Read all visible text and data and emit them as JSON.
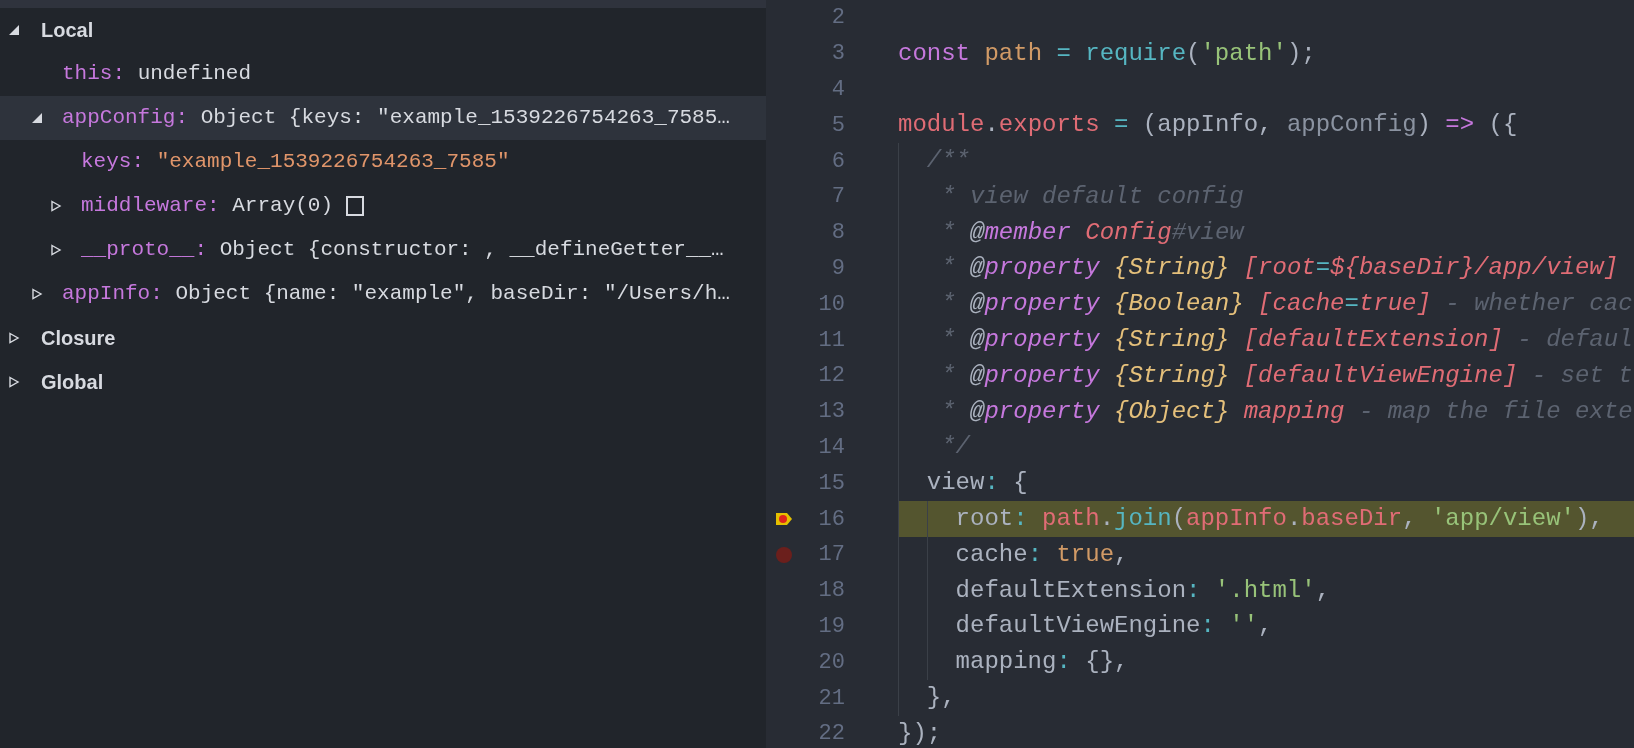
{
  "scope_tree": [
    {
      "label": "Local",
      "kind": "section",
      "expanded": true,
      "children": [
        {
          "name": "this:",
          "value": "undefined",
          "kind": "leaf",
          "string_value": false,
          "selected": false
        },
        {
          "name": "appConfig:",
          "value": "Object {keys: \"example_1539226754263_7585…",
          "kind": "object",
          "expanded": true,
          "string_value": false,
          "selected": true,
          "children": [
            {
              "name": "keys:",
              "value": "\"example_1539226754263_7585\"",
              "kind": "leaf",
              "string_value": true,
              "selected": false
            },
            {
              "name": "middleware:",
              "value": "Array(0)",
              "kind": "array",
              "expanded": false,
              "string_value": false,
              "selected": false
            },
            {
              "name": "__proto__:",
              "value": "Object {constructor: , __defineGetter__…",
              "kind": "object",
              "expanded": false,
              "string_value": false,
              "selected": false
            }
          ]
        },
        {
          "name": "appInfo:",
          "value": "Object {name: \"example\", baseDir: \"/Users/h…",
          "kind": "object",
          "expanded": false,
          "string_value": false,
          "selected": false
        }
      ]
    },
    {
      "label": "Closure",
      "kind": "section",
      "expanded": false
    },
    {
      "label": "Global",
      "kind": "section",
      "expanded": false
    }
  ],
  "editor": {
    "lines": [
      {
        "number": "2",
        "breakpoint": false,
        "paused": false,
        "highlighted": false
      },
      {
        "number": "3",
        "breakpoint": false,
        "paused": false,
        "highlighted": false,
        "tokens": [
          {
            "text": "const",
            "kind": "keyword"
          },
          {
            "text": " path",
            "kind": "variable"
          },
          {
            "text": " =",
            "kind": "operator"
          },
          {
            "text": " require",
            "kind": "function"
          },
          {
            "text": "(",
            "kind": "plain"
          },
          {
            "text": "'path'",
            "kind": "string"
          },
          {
            "text": ");",
            "kind": "plain"
          }
        ]
      },
      {
        "number": "4",
        "breakpoint": false,
        "paused": false,
        "highlighted": false
      },
      {
        "number": "5",
        "breakpoint": false,
        "paused": false,
        "highlighted": false,
        "tokens": [
          {
            "text": "module",
            "kind": "member"
          },
          {
            "text": ".",
            "kind": "plain"
          },
          {
            "text": "exports",
            "kind": "member"
          },
          {
            "text": " =",
            "kind": "operator"
          },
          {
            "text": " (appInfo, ",
            "kind": "plain"
          },
          {
            "text": "appConfig",
            "kind": "unused"
          },
          {
            "text": ") ",
            "kind": "plain"
          },
          {
            "text": "=>",
            "kind": "keyword"
          },
          {
            "text": " ({",
            "kind": "plain"
          }
        ]
      },
      {
        "number": "6",
        "breakpoint": false,
        "paused": false,
        "highlighted": false,
        "tokens": [
          {
            "text": "  /**",
            "kind": "comment"
          }
        ]
      },
      {
        "number": "7",
        "breakpoint": false,
        "paused": false,
        "highlighted": false,
        "tokens": [
          {
            "text": "   * view default config",
            "kind": "comment"
          }
        ]
      },
      {
        "number": "8",
        "breakpoint": false,
        "paused": false,
        "highlighted": false,
        "tokens": [
          {
            "text": "   * ",
            "kind": "comment"
          },
          {
            "text": "@",
            "kind": "doc_at"
          },
          {
            "text": "member ",
            "kind": "doc_tag"
          },
          {
            "text": "Config",
            "kind": "doc_name"
          },
          {
            "text": "#view",
            "kind": "comment"
          }
        ]
      },
      {
        "number": "9",
        "breakpoint": false,
        "paused": false,
        "highlighted": false,
        "tokens": [
          {
            "text": "   * ",
            "kind": "comment"
          },
          {
            "text": "@",
            "kind": "doc_at"
          },
          {
            "text": "property ",
            "kind": "doc_tag"
          },
          {
            "text": "{String} ",
            "kind": "doc_type"
          },
          {
            "text": "[root",
            "kind": "doc_name"
          },
          {
            "text": "=",
            "kind": "doc_op"
          },
          {
            "text": "${baseDir}/app/view]",
            "kind": "doc_name"
          }
        ]
      },
      {
        "number": "10",
        "breakpoint": false,
        "paused": false,
        "highlighted": false,
        "tokens": [
          {
            "text": "   * ",
            "kind": "comment"
          },
          {
            "text": "@",
            "kind": "doc_at"
          },
          {
            "text": "property ",
            "kind": "doc_tag"
          },
          {
            "text": "{Boolean} ",
            "kind": "doc_type"
          },
          {
            "text": "[cache",
            "kind": "doc_name"
          },
          {
            "text": "=",
            "kind": "doc_op"
          },
          {
            "text": "true]",
            "kind": "doc_name"
          },
          {
            "text": " - whether cac",
            "kind": "comment"
          }
        ]
      },
      {
        "number": "11",
        "breakpoint": false,
        "paused": false,
        "highlighted": false,
        "tokens": [
          {
            "text": "   * ",
            "kind": "comment"
          },
          {
            "text": "@",
            "kind": "doc_at"
          },
          {
            "text": "property ",
            "kind": "doc_tag"
          },
          {
            "text": "{String} ",
            "kind": "doc_type"
          },
          {
            "text": "[defaultExtension]",
            "kind": "doc_name"
          },
          {
            "text": " - defaul",
            "kind": "comment"
          }
        ]
      },
      {
        "number": "12",
        "breakpoint": false,
        "paused": false,
        "highlighted": false,
        "tokens": [
          {
            "text": "   * ",
            "kind": "comment"
          },
          {
            "text": "@",
            "kind": "doc_at"
          },
          {
            "text": "property ",
            "kind": "doc_tag"
          },
          {
            "text": "{String} ",
            "kind": "doc_type"
          },
          {
            "text": "[defaultViewEngine]",
            "kind": "doc_name"
          },
          {
            "text": " - set t",
            "kind": "comment"
          }
        ]
      },
      {
        "number": "13",
        "breakpoint": false,
        "paused": false,
        "highlighted": false,
        "tokens": [
          {
            "text": "   * ",
            "kind": "comment"
          },
          {
            "text": "@",
            "kind": "doc_at"
          },
          {
            "text": "property ",
            "kind": "doc_tag"
          },
          {
            "text": "{Object} ",
            "kind": "doc_type"
          },
          {
            "text": "mapping",
            "kind": "doc_name"
          },
          {
            "text": " - map the file exte",
            "kind": "comment"
          }
        ]
      },
      {
        "number": "14",
        "breakpoint": false,
        "paused": false,
        "highlighted": false,
        "tokens": [
          {
            "text": "   */",
            "kind": "comment"
          }
        ]
      },
      {
        "number": "15",
        "breakpoint": false,
        "paused": false,
        "highlighted": false,
        "tokens": [
          {
            "text": "  view",
            "kind": "plain"
          },
          {
            "text": ":",
            "kind": "operator"
          },
          {
            "text": " {",
            "kind": "plain"
          }
        ]
      },
      {
        "number": "16",
        "breakpoint": true,
        "paused": true,
        "highlighted": true,
        "tokens": [
          {
            "text": "    root",
            "kind": "plain"
          },
          {
            "text": ": ",
            "kind": "operator"
          },
          {
            "text": "path",
            "kind": "member"
          },
          {
            "text": ".",
            "kind": "plain"
          },
          {
            "text": "join",
            "kind": "function"
          },
          {
            "text": "(",
            "kind": "plain"
          },
          {
            "text": "appInfo",
            "kind": "member"
          },
          {
            "text": ".",
            "kind": "plain"
          },
          {
            "text": "baseDir",
            "kind": "member"
          },
          {
            "text": ", ",
            "kind": "plain"
          },
          {
            "text": "'app/view'",
            "kind": "string"
          },
          {
            "text": "),",
            "kind": "plain"
          }
        ]
      },
      {
        "number": "17",
        "breakpoint": true,
        "paused": false,
        "highlighted": false,
        "tokens": [
          {
            "text": "    cache",
            "kind": "plain"
          },
          {
            "text": ": ",
            "kind": "operator"
          },
          {
            "text": "true",
            "kind": "variable"
          },
          {
            "text": ",",
            "kind": "plain"
          }
        ]
      },
      {
        "number": "18",
        "breakpoint": false,
        "paused": false,
        "highlighted": false,
        "tokens": [
          {
            "text": "    defaultExtension",
            "kind": "plain"
          },
          {
            "text": ": ",
            "kind": "operator"
          },
          {
            "text": "'.html'",
            "kind": "string"
          },
          {
            "text": ",",
            "kind": "plain"
          }
        ]
      },
      {
        "number": "19",
        "breakpoint": false,
        "paused": false,
        "highlighted": false,
        "tokens": [
          {
            "text": "    defaultViewEngine",
            "kind": "plain"
          },
          {
            "text": ": ",
            "kind": "operator"
          },
          {
            "text": "''",
            "kind": "string"
          },
          {
            "text": ",",
            "kind": "plain"
          }
        ]
      },
      {
        "number": "20",
        "breakpoint": false,
        "paused": false,
        "highlighted": false,
        "tokens": [
          {
            "text": "    mapping",
            "kind": "plain"
          },
          {
            "text": ":",
            "kind": "operator"
          },
          {
            "text": " {},",
            "kind": "plain"
          }
        ]
      },
      {
        "number": "21",
        "breakpoint": false,
        "paused": false,
        "highlighted": false,
        "tokens": [
          {
            "text": "  },",
            "kind": "plain"
          }
        ]
      },
      {
        "number": "22",
        "breakpoint": false,
        "paused": false,
        "highlighted": false,
        "tokens": [
          {
            "text": "});",
            "kind": "plain"
          }
        ]
      }
    ]
  }
}
